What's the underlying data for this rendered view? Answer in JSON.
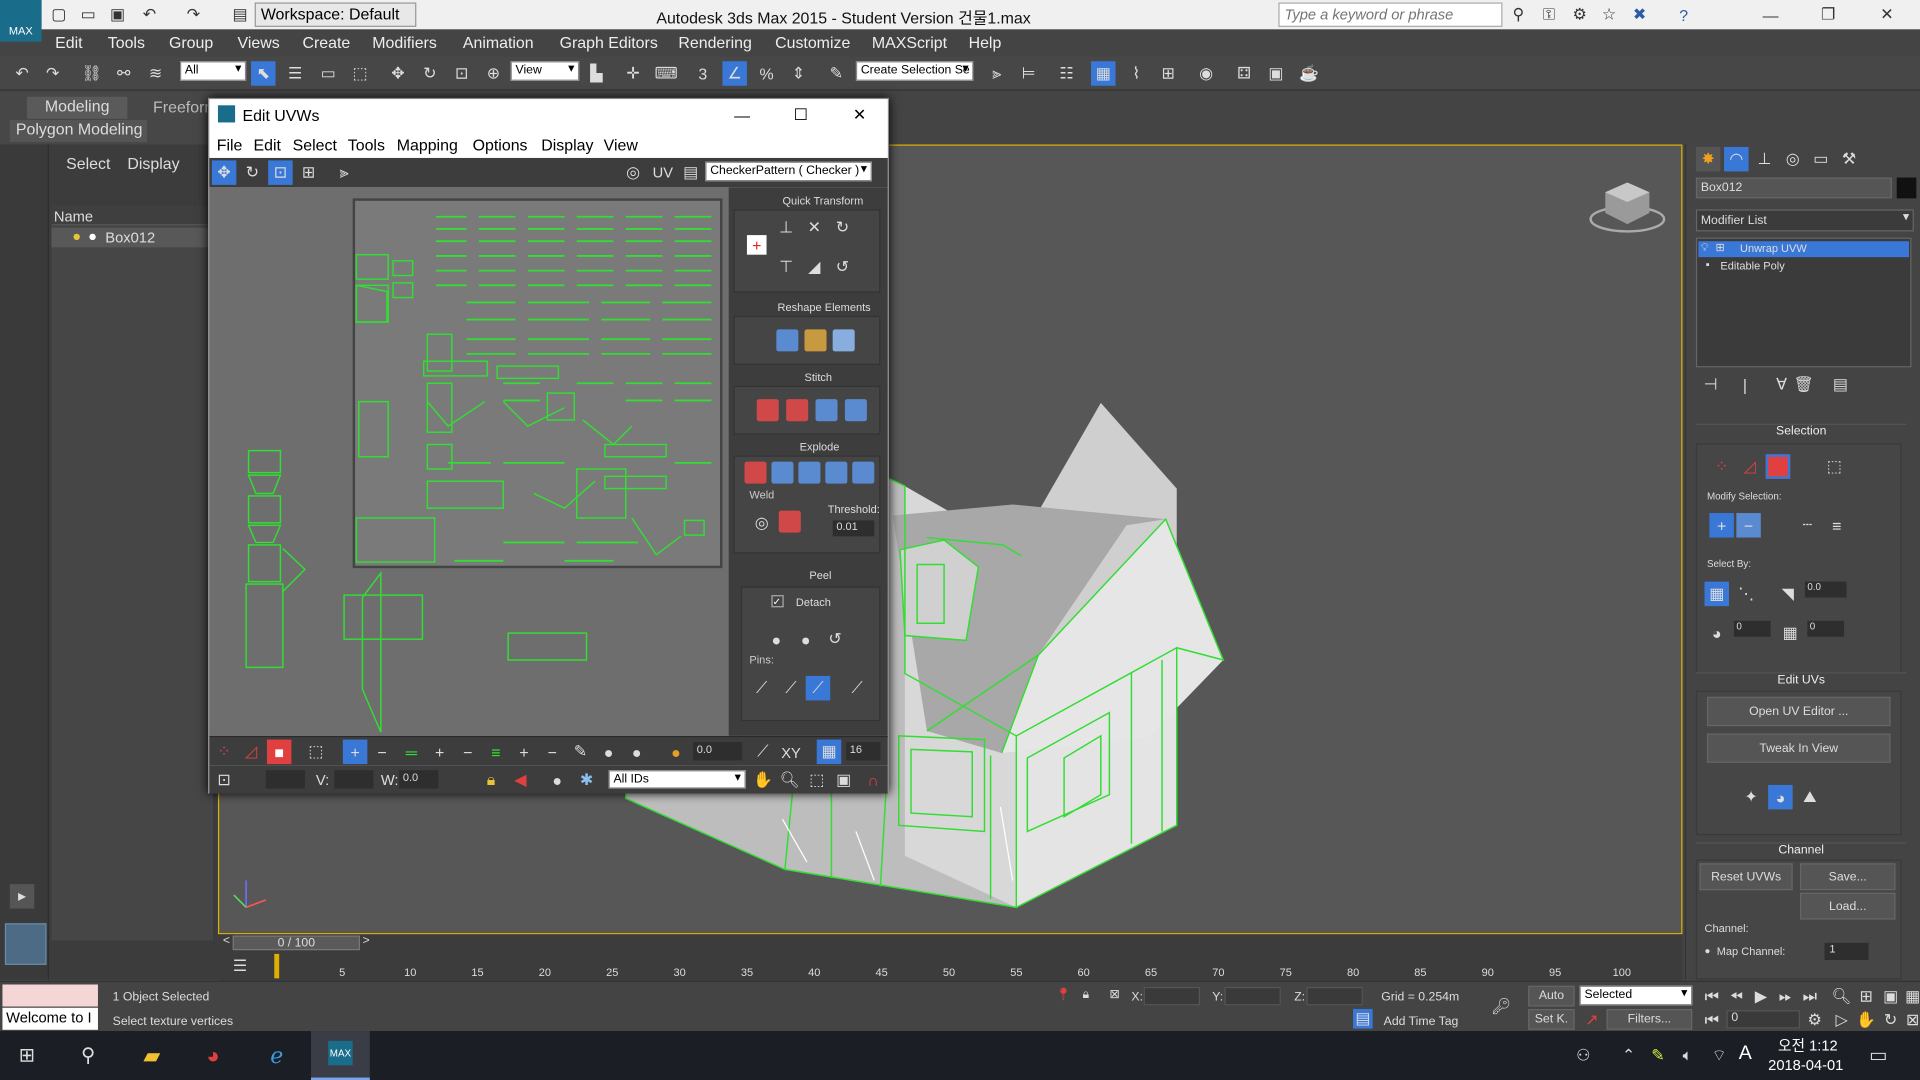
{
  "titlebar": {
    "workspace": "Workspace: Default",
    "title": "Autodesk 3ds Max  2015   - Student Version     건물1.max",
    "search_placeholder": "Type a keyword or phrase"
  },
  "menu": [
    "Edit",
    "Tools",
    "Group",
    "Views",
    "Create",
    "Modifiers",
    "Animation",
    "Graph Editors",
    "Rendering",
    "Customize",
    "MAXScript",
    "Help"
  ],
  "toolbar": {
    "filter": "All",
    "refcoord": "View",
    "selset": "Create Selection Se"
  },
  "ribbon": {
    "tabs": [
      "Modeling",
      "Freeform"
    ],
    "sub": "Polygon Modeling"
  },
  "scene": {
    "tabs": [
      "Select",
      "Display"
    ],
    "column": "Name",
    "item": "Box012"
  },
  "uvw": {
    "title": "Edit UVWs",
    "menu": [
      "File",
      "Edit",
      "Select",
      "Tools",
      "Mapping",
      "Options",
      "Display",
      "View"
    ],
    "uv_label": "UV",
    "checker": "CheckerPattern  ( Checker )",
    "panels": {
      "quick": "Quick Transform",
      "reshape": "Reshape Elements",
      "stitch": "Stitch",
      "explode": "Explode",
      "weld": "Weld",
      "threshold": "Threshold:",
      "threshold_val": "0.01",
      "peel": "Peel",
      "detach": "Detach",
      "pins": "Pins:"
    },
    "bottom": {
      "spin": "0.0",
      "xy": "XY",
      "num": "16",
      "v": "V:",
      "w": "W:",
      "w_val": "0.0",
      "ids": "All IDs"
    }
  },
  "cmd": {
    "object_name": "Box012",
    "modifier_list": "Modifier List",
    "stack": [
      "Unwrap UVW",
      "Editable Poly"
    ],
    "selection": "Selection",
    "modify_selection": "Modify Selection:",
    "select_by": "Select By:",
    "angle": "0.0",
    "v1": "0",
    "v2": "0",
    "edit_uvs": "Edit UVs",
    "open_uv": "Open UV Editor ...",
    "tweak": "Tweak In View",
    "channel": "Channel",
    "reset": "Reset UVWs",
    "save": "Save...",
    "load": "Load...",
    "channel_label": "Channel:",
    "map_channel": "Map Channel:",
    "map_val": "1"
  },
  "timeline": {
    "frame": "0 / 100",
    "ticks": [
      "5",
      "10",
      "15",
      "20",
      "25",
      "30",
      "35",
      "40",
      "45",
      "50",
      "55",
      "60",
      "65",
      "70",
      "75",
      "80",
      "85",
      "90",
      "95",
      "100"
    ]
  },
  "status": {
    "welcome": "Welcome to I",
    "selected": "1 Object Selected",
    "prompt": "Select texture vertices",
    "x": "X:",
    "y": "Y:",
    "z": "Z:",
    "grid": "Grid = 0.254m",
    "auto": "Auto",
    "setk": "Set K.",
    "sel_mode": "Selected",
    "filters": "Filters...",
    "add_time_tag": "Add Time Tag",
    "frame_field": "0"
  },
  "taskbar": {
    "time": "오전 1:12",
    "date": "2018-04-01",
    "ime": "A"
  },
  "colors": {
    "selected_blue": "#3a78d8",
    "wire_green": "#33dd33"
  }
}
